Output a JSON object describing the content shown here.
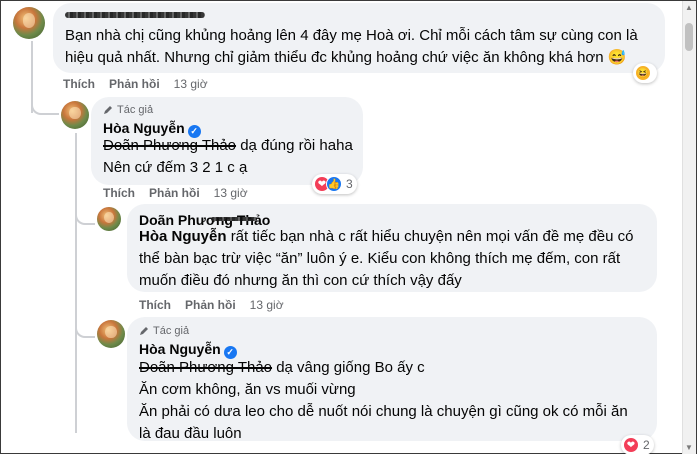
{
  "comments": [
    {
      "id": "c1",
      "text": "Bạn nhà chị cũng khủng hoảng lên 4 đây mẹ Hoà ơi. Chỉ mỗi cách tâm sự cùng con là hiệu quả nhất. Nhưng chỉ giảm thiểu đc khủng hoảng chứ việc ăn không khá hơn",
      "emoji": "😅",
      "actions": {
        "like": "Thích",
        "reply": "Phản hồi",
        "time": "13 giờ"
      },
      "reaction_emoji": "😆"
    },
    {
      "id": "c2",
      "author_badge": "Tác giả",
      "name": "Hòa Nguyễn",
      "verified": "✓",
      "mention": "Doãn Phương Thảo",
      "line1": "dạ đúng rồi haha",
      "line2": "Nên cứ đếm 3 2 1 c ạ",
      "actions": {
        "like": "Thích",
        "reply": "Phản hồi",
        "time": "13 giờ"
      },
      "reactions": {
        "heart": "❤",
        "like": "👍",
        "count": "3"
      }
    },
    {
      "id": "c3",
      "name": "Doãn Phương Thảo",
      "mention": "Hòa Nguyễn",
      "text": "rất tiếc bạn nhà c rất hiểu chuyện nên mọi vấn đề mẹ đều có thể bàn bạc trừ việc “ăn” luôn ý e. Kiểu con không thích mẹ đếm, con rất muốn điều đó nhưng ăn thì con cứ thích vậy đấy",
      "actions": {
        "like": "Thích",
        "reply": "Phản hồi",
        "time": "13 giờ"
      }
    },
    {
      "id": "c4",
      "author_badge": "Tác giả",
      "name": "Hòa Nguyễn",
      "verified": "✓",
      "mention": "Doãn Phương Thảo",
      "line1": "dạ vâng giống Bo ấy c",
      "line2": "Ăn cơm không, ăn vs muối vừng",
      "line3": "Ăn phải có dưa leo cho dễ nuốt nói chung là chuyện gì cũng ok có mỗi ăn là đau đầu luôn",
      "reactions": {
        "heart": "❤",
        "count": "2"
      }
    }
  ],
  "icons": {
    "pencil": "pencil-icon",
    "scroll_up": "▲",
    "scroll_down": "▼"
  }
}
